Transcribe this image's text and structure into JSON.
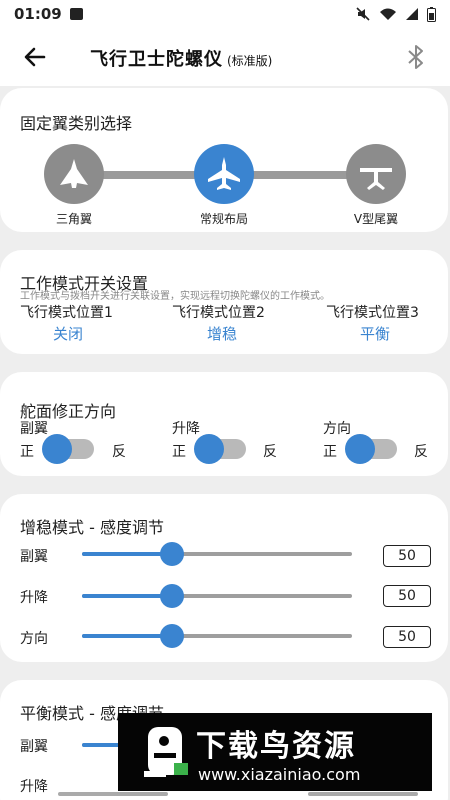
{
  "status": {
    "time": "01:09"
  },
  "header": {
    "title": "飞行卫士陀螺仪",
    "subtitle": "(标准版)"
  },
  "wing_select": {
    "title": "固定翼类别选择",
    "options": [
      {
        "label": "三角翼",
        "selected": false
      },
      {
        "label": "常规布局",
        "selected": true
      },
      {
        "label": "V型尾翼",
        "selected": false
      }
    ]
  },
  "mode_switch": {
    "title": "工作模式开关设置",
    "desc": "工作模式与拨档开关进行关联设置，实现远程切换陀螺仪的工作模式。",
    "positions": [
      {
        "label": "飞行模式位置1",
        "value": "关闭"
      },
      {
        "label": "飞行模式位置2",
        "value": "增稳"
      },
      {
        "label": "飞行模式位置3",
        "value": "平衡"
      }
    ]
  },
  "direction": {
    "title": "舵面修正方向",
    "items": [
      {
        "label": "副翼",
        "left": "正",
        "right": "反"
      },
      {
        "label": "升降",
        "left": "正",
        "right": "反"
      },
      {
        "label": "方向",
        "left": "正",
        "right": "反"
      }
    ]
  },
  "stab_gain": {
    "title": "增稳模式 - 感度调节",
    "rows": [
      {
        "label": "副翼",
        "value": "50",
        "fraction": 0.33
      },
      {
        "label": "升降",
        "value": "50",
        "fraction": 0.33
      },
      {
        "label": "方向",
        "value": "50",
        "fraction": 0.33
      }
    ]
  },
  "balance_gain": {
    "title": "平衡模式 - 感度调节",
    "rows": [
      {
        "label": "副翼"
      },
      {
        "label": "升降"
      }
    ]
  },
  "banner": {
    "text": "下载鸟资源",
    "url": "www.xiazainiao.com"
  },
  "colors": {
    "accent": "#3a84d0",
    "inactive": "#8c8c8c"
  }
}
